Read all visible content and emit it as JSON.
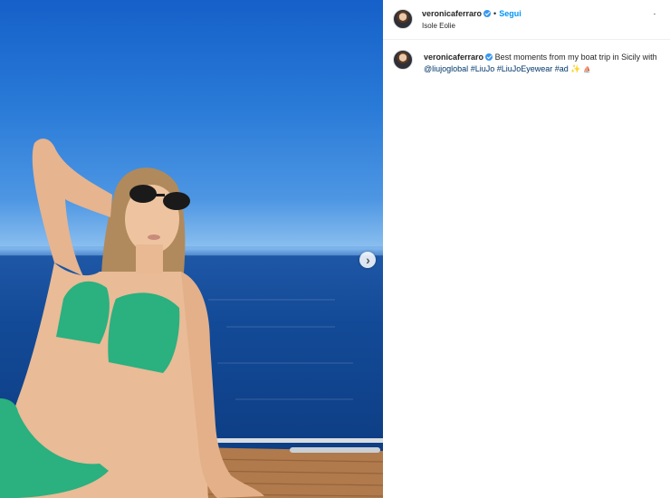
{
  "post": {
    "username": "veronicaferraro",
    "separator": "•",
    "follow_label": "Segui",
    "location": "Isole Eolie",
    "more_icon": "⋅",
    "next_icon": "›"
  },
  "caption": {
    "username": "veronicaferraro",
    "text_before": "Best moments from my boat trip in Sicily with",
    "mention": "@liujoglobal",
    "hashtags": [
      "#LiuJo",
      "#LiuJoEyewear",
      "#ad"
    ],
    "emoji_1": "✨",
    "emoji_2": "⛵"
  },
  "colors": {
    "accent": "#0095f6",
    "link": "#00376b",
    "verified": "#3897f0",
    "bikini": "#2bb07f",
    "sky": "#2a7bd8",
    "sea": "#134a97"
  }
}
